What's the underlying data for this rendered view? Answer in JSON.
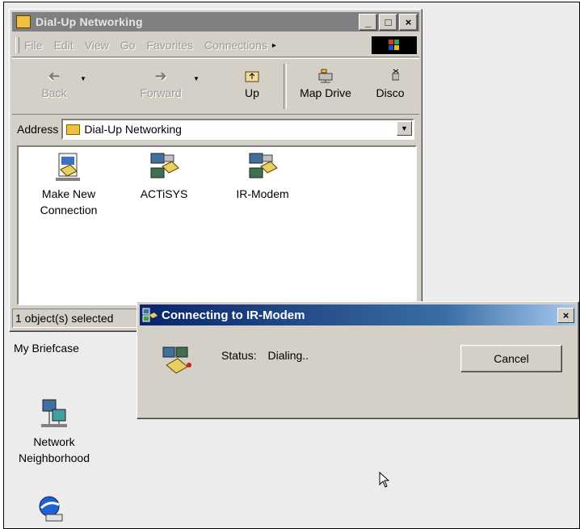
{
  "explorer": {
    "title": "Dial-Up Networking",
    "caption_buttons": {
      "minimize": "_",
      "maximize": "□",
      "close": "×"
    },
    "menu": [
      {
        "label": "File"
      },
      {
        "label": "Edit"
      },
      {
        "label": "View"
      },
      {
        "label": "Go"
      },
      {
        "label": "Favorites"
      },
      {
        "label": "Connections"
      }
    ],
    "menu_more": "▸",
    "toolbar": {
      "back": "Back",
      "forward": "Forward",
      "up": "Up",
      "map_drive": "Map Drive",
      "disconnect": "Disco"
    },
    "address": {
      "label": "Address",
      "value": "Dial-Up Networking",
      "dropdown": "▼"
    },
    "items": [
      {
        "label_line1": "Make New",
        "label_line2": "Connection",
        "icon": "make-new-connection-icon"
      },
      {
        "label_line1": "ACTiSYS",
        "label_line2": "",
        "icon": "connection-icon"
      },
      {
        "label_line1": "IR-Modem",
        "label_line2": "",
        "icon": "connection-icon"
      }
    ],
    "status_text": "1 object(s) selected"
  },
  "desktop": {
    "briefcase_label": "My Briefcase",
    "network_line1": "Network",
    "network_line2": "Neighborhood"
  },
  "dialog": {
    "title": "Connecting to IR-Modem",
    "close": "×",
    "status_label": "Status:",
    "status_value": "Dialing..",
    "cancel_label": "Cancel"
  },
  "colors": {
    "title_active_start": "#0a246a",
    "title_inactive": "#808080",
    "face": "#d4d0c8"
  }
}
